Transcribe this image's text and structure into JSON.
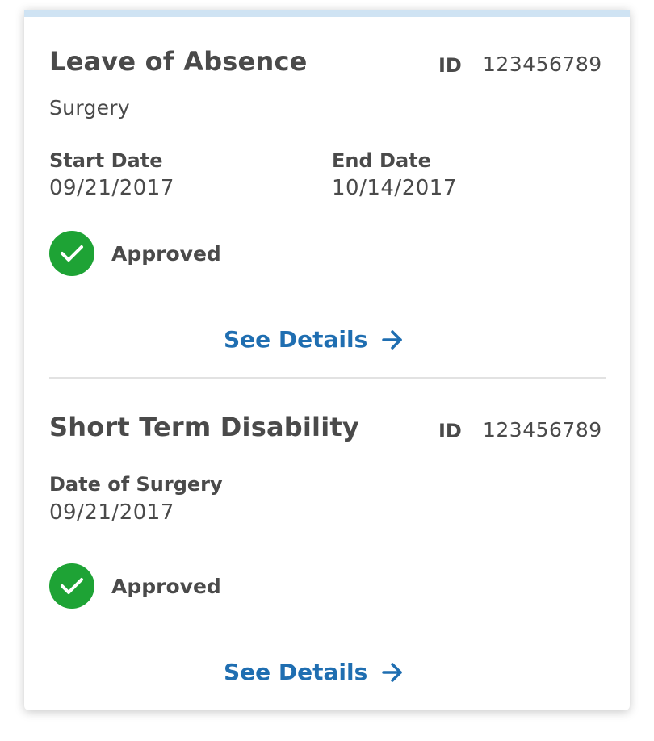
{
  "claims": [
    {
      "title": "Leave of Absence",
      "id_label": "ID",
      "id_value": "123456789",
      "subtitle": "Surgery",
      "fields": [
        {
          "label": "Start Date",
          "value": "09/21/2017"
        },
        {
          "label": "End Date",
          "value": "10/14/2017"
        }
      ],
      "status": "Approved",
      "link_label": "See Details"
    },
    {
      "title": "Short Term Disability",
      "id_label": "ID",
      "id_value": "123456789",
      "fields": [
        {
          "label": "Date of Surgery",
          "value": "09/21/2017"
        }
      ],
      "status": "Approved",
      "link_label": "See Details"
    }
  ],
  "colors": {
    "accent_bar": "#cfe3f3",
    "status_approved": "#1ea335",
    "link": "#1f6eb1",
    "text": "#4a4a4a"
  },
  "icons": {
    "status": "check-icon",
    "link": "arrow-right-icon"
  }
}
